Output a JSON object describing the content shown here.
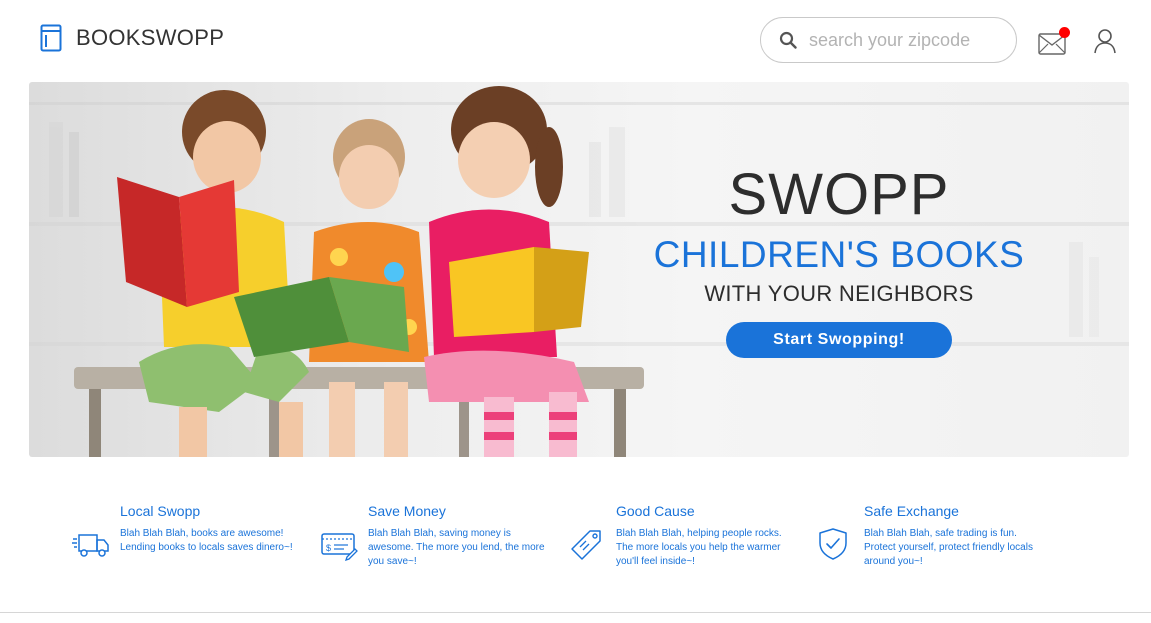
{
  "header": {
    "logo_text": "BOOKSWOPP",
    "search_placeholder": "search your zipcode",
    "mail_icon": "mail-icon",
    "notification_color": "#ff0000",
    "user_icon": "user-icon"
  },
  "hero": {
    "title": "SWOPP",
    "subtitle": "CHILDREN'S BOOKS",
    "tagline": "WITH YOUR NEIGHBORS",
    "cta_label": "Start Swopping!",
    "image": "children-reading-books-photo"
  },
  "features": [
    {
      "icon": "truck-icon",
      "title": "Local Swopp",
      "desc": "Blah Blah Blah, books are awesome! Lending books to locals saves dinero~!"
    },
    {
      "icon": "money-icon",
      "title": "Save Money",
      "desc": "Blah Blah Blah, saving money is awesome. The more you lend, the more you save~!"
    },
    {
      "icon": "tag-icon",
      "title": "Good Cause",
      "desc": "Blah Blah Blah, helping people rocks. The more locals you help the warmer you'll feel inside~!"
    },
    {
      "icon": "shield-check-icon",
      "title": "Safe Exchange",
      "desc": "Blah Blah Blah, safe trading is fun. Protect yourself, protect friendly locals around you~!"
    }
  ],
  "colors": {
    "accent": "#1a73d9",
    "text_dark": "#2d2d2d"
  }
}
